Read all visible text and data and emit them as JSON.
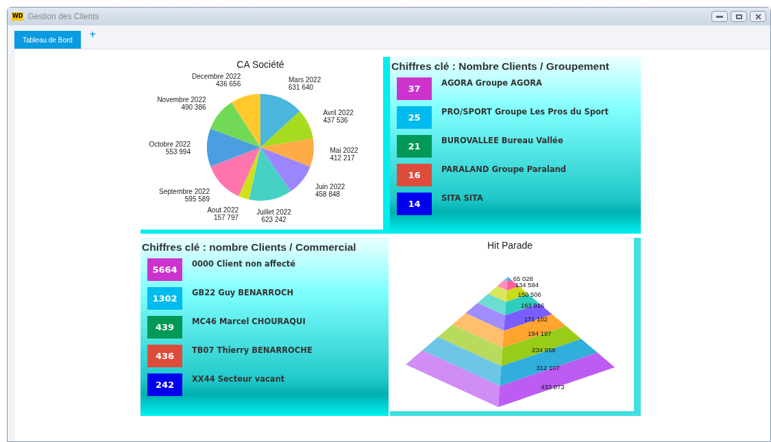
{
  "window": {
    "logo": "WD",
    "title": "Gestion des Clients"
  },
  "tabs": [
    {
      "label": "Tableau de Bord",
      "selected": true
    }
  ],
  "add_tab": "+",
  "ca_societe": {
    "chart_data": {
      "type": "pie",
      "title": "CA Société",
      "categories": [
        "Mars 2022",
        "Avril 2022",
        "Mai 2022",
        "Juin 2022",
        "Juillet 2022",
        "Aout 2022",
        "Septembre 2022",
        "Octobre 2022",
        "Novembre 2022",
        "Decembre 2022"
      ],
      "values": [
        631640,
        437536,
        412217,
        458848,
        623242,
        157797,
        595589,
        553994,
        490386,
        436656
      ],
      "data_labels": true
    }
  },
  "groupement": {
    "title": "Chiffres clé : Nombre Clients / Groupement",
    "items": [
      {
        "count": "37",
        "label": "AGORA Groupe AGORA",
        "color": "#cc33cc"
      },
      {
        "count": "25",
        "label": "PRO/SPORT Groupe Les Pros du Sport",
        "color": "#00bbee"
      },
      {
        "count": "21",
        "label": "BUROVALLEE Bureau Vallée",
        "color": "#009955"
      },
      {
        "count": "16",
        "label": "PARALAND Groupe Paraland",
        "color": "#dd4c3a"
      },
      {
        "count": "14",
        "label": "SITA SITA",
        "color": "#0000ee"
      }
    ]
  },
  "commercial": {
    "title": "Chiffres clé : nombre Clients / Commercial",
    "items": [
      {
        "count": "5664",
        "label": "0000 Client non affecté",
        "color": "#cc33cc"
      },
      {
        "count": "1302",
        "label": "GB22 Guy BENARROCH",
        "color": "#00bbee"
      },
      {
        "count": "439",
        "label": "MC46 Marcel CHOURAQUI",
        "color": "#009955"
      },
      {
        "count": "436",
        "label": "TB07 Thierry BENARROCHE",
        "color": "#dd4c3a"
      },
      {
        "count": "242",
        "label": "XX44 Secteur vacant",
        "color": "#0000ee"
      }
    ]
  },
  "hit_parade": {
    "title": "Hit Parade",
    "layers": [
      {
        "value": "65 028"
      },
      {
        "value": "134 594"
      },
      {
        "value": "150 506"
      },
      {
        "value": "163 916"
      },
      {
        "value": "171 102"
      },
      {
        "value": "194 197"
      },
      {
        "value": "234 956"
      },
      {
        "value": "312 107"
      },
      {
        "value": "433 073"
      }
    ]
  }
}
